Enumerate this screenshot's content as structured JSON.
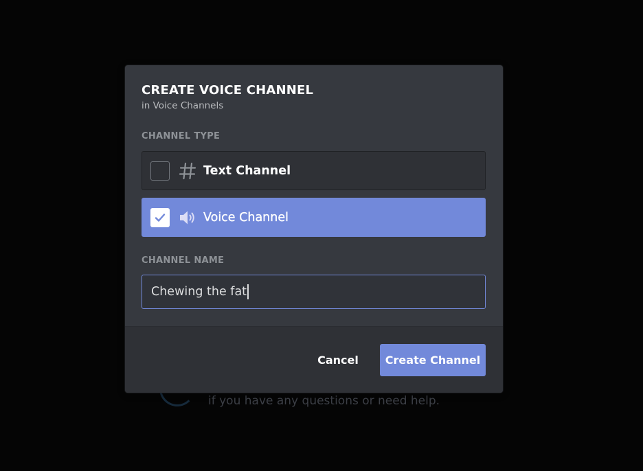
{
  "background": {
    "help_text": "if you have any questions or need help."
  },
  "modal": {
    "title": "CREATE VOICE CHANNEL",
    "subtitle": "in Voice Channels",
    "channel_type": {
      "label": "CHANNEL TYPE",
      "options": [
        {
          "label": "Text Channel",
          "icon": "hash-icon",
          "selected": false
        },
        {
          "label": "Voice Channel",
          "icon": "speaker-icon",
          "selected": true
        }
      ]
    },
    "channel_name": {
      "label": "CHANNEL NAME",
      "value": "Chewing the fat"
    },
    "footer": {
      "cancel_label": "Cancel",
      "create_label": "Create Channel"
    }
  },
  "colors": {
    "accent": "#7289da",
    "modal_bg": "#36393f",
    "footer_bg": "#2f3136",
    "backdrop": "#050505"
  }
}
